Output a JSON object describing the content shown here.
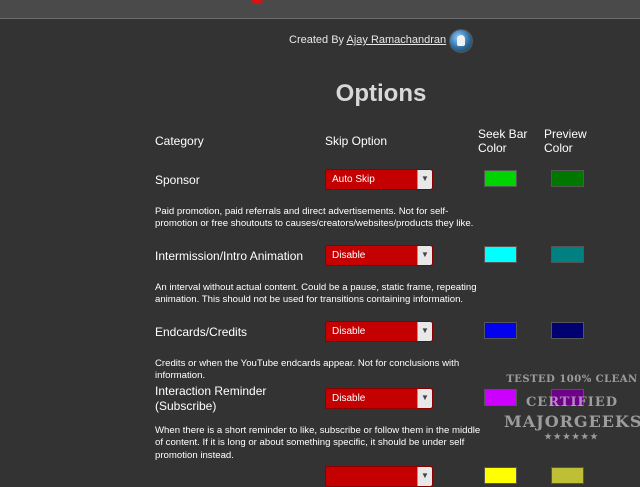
{
  "credit": {
    "prefix": "Created By",
    "author": "Ajay Ramachandran"
  },
  "title": "Options",
  "headers": {
    "category": "Category",
    "skip_option": "Skip Option",
    "seek_bar_color": "Seek Bar Color",
    "preview_color": "Preview Color"
  },
  "rows": [
    {
      "category": "Sponsor",
      "skip_option": "Auto Skip",
      "seek_color": "#00d400",
      "preview_color": "#007800",
      "description": "Paid promotion, paid referrals and direct advertisements. Not for self-promotion or free shoutouts to causes/creators/websites/products they like."
    },
    {
      "category": "Intermission/Intro Animation",
      "skip_option": "Disable",
      "seek_color": "#00ffff",
      "preview_color": "#008080",
      "description": "An interval without actual content. Could be a pause, static frame, repeating animation. This should not be used for transitions containing information."
    },
    {
      "category": "Endcards/Credits",
      "skip_option": "Disable",
      "seek_color": "#0202ed",
      "preview_color": "#000070",
      "description": "Credits or when the YouTube endcards appear. Not for conclusions with information."
    },
    {
      "category": "Interaction Reminder (Subscribe)",
      "skip_option": "Disable",
      "seek_color": "#cc00ff",
      "preview_color": "#6c0087",
      "description": "When there is a short reminder to like, subscribe or follow them in the middle of content. If it is long or about something specific, it should be under self promotion instead."
    },
    {
      "category": "",
      "skip_option": "",
      "seek_color": "#ffff00",
      "preview_color": "#bfbf35",
      "description": ""
    }
  ],
  "watermark": {
    "line1": "TESTED 100% CLEAN",
    "line2": "CERTIFIED",
    "line3": "MAJORGEEKS",
    "stars": "★★★★★★"
  }
}
